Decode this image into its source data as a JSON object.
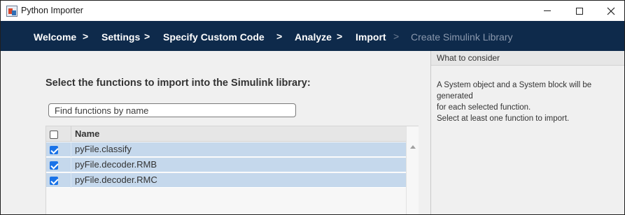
{
  "window": {
    "title": "Python Importer"
  },
  "breadcrumb": {
    "steps": [
      {
        "label": "Welcome",
        "state": "done"
      },
      {
        "label": "Settings",
        "state": "done"
      },
      {
        "label": "Specify Custom Code",
        "state": "done"
      },
      {
        "label": "Analyze",
        "state": "done"
      },
      {
        "label": "Import",
        "state": "current"
      },
      {
        "label": "Create Simulink Library",
        "state": "upcoming"
      }
    ],
    "separator": ">"
  },
  "main": {
    "heading": "Select the functions to import into the Simulink library:",
    "search_placeholder": "Find functions by name",
    "table": {
      "select_all_checked": false,
      "column_name": "Name",
      "rows": [
        {
          "label": "pyFile.classify",
          "checked": true
        },
        {
          "label": "pyFile.decoder.RMB",
          "checked": true
        },
        {
          "label": "pyFile.decoder.RMC",
          "checked": true
        }
      ]
    }
  },
  "sidebar": {
    "title": "What to consider",
    "lines": [
      "A System object and a System block will be generated",
      "for each selected function.",
      "Select at least one function to import."
    ]
  },
  "colors": {
    "banner": "#0e2a4b",
    "row_selected": "#c5d8ec",
    "checkbox": "#1a73e8"
  }
}
